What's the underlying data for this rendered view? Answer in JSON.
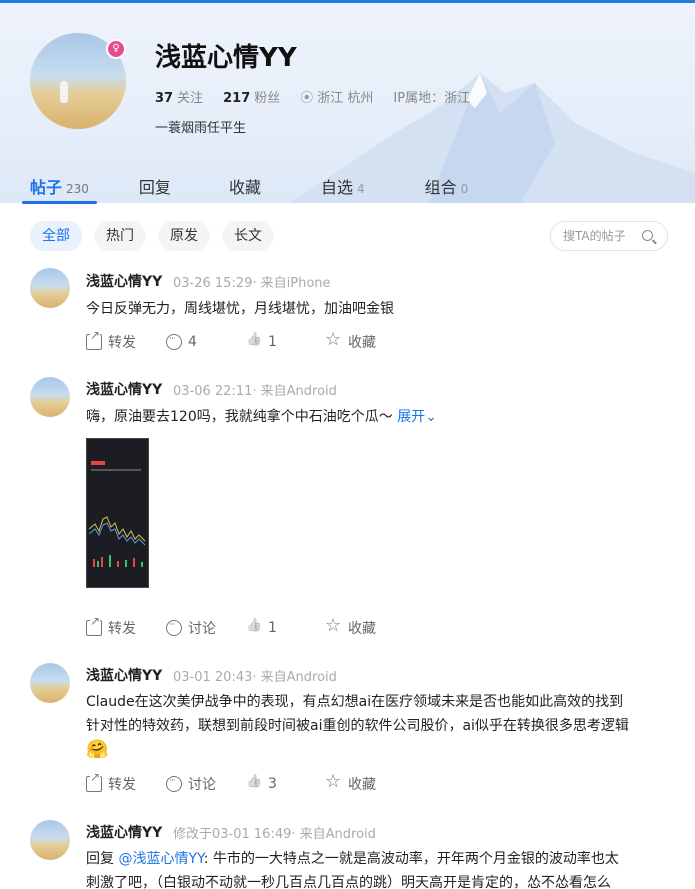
{
  "profile": {
    "name": "浅蓝心情YY",
    "following_count": "37",
    "following_label": "关注",
    "followers_count": "217",
    "followers_label": "粉丝",
    "location": "浙江 杭州",
    "ip_location": "IP属地：浙江",
    "bio": "一蓑烟雨任平生"
  },
  "tabs": [
    {
      "label": "帖子",
      "count": "230"
    },
    {
      "label": "回复",
      "count": ""
    },
    {
      "label": "收藏",
      "count": ""
    },
    {
      "label": "自选",
      "count": "4"
    },
    {
      "label": "组合",
      "count": "0"
    }
  ],
  "filters": [
    "全部",
    "热门",
    "原发",
    "长文"
  ],
  "search": {
    "placeholder": "搜TA的帖子"
  },
  "posts": [
    {
      "author": "浅蓝心情YY",
      "meta": "03-26 15:29· 来自iPhone",
      "body": "今日反弹无力，周线堪忧，月线堪忧，加油吧金银",
      "share": "转发",
      "comments": "4",
      "likes": "1",
      "fav": "收藏"
    },
    {
      "author": "浅蓝心情YY",
      "meta": "03-06 22:11· 来自Android",
      "body": "嗨，原油要去120吗，我就纯拿个中石油吃个瓜～",
      "expand": "展开",
      "share": "转发",
      "comments": "讨论",
      "likes": "1",
      "fav": "收藏"
    },
    {
      "author": "浅蓝心情YY",
      "meta": "03-01 20:43· 来自Android",
      "body_line1": "Claude在这次美伊战争中的表现，有点幻想ai在医疗领域未来是否也能如此高效的找到",
      "body_line2": "针对性的特效药，联想到前段时间被ai重创的软件公司股价，ai似乎在转换很多思考逻辑",
      "emoji": "🤗",
      "share": "转发",
      "comments": "讨论",
      "likes": "3",
      "fav": "收藏"
    },
    {
      "author": "浅蓝心情YY",
      "meta": "修改于03-01 16:49· 来自Android",
      "reply_prefix": "回复",
      "mention": "@浅蓝心情YY",
      "body_line1": ": 牛市的一大特点之一就是高波动率，开年两个月金银的波动率也太",
      "body_line2": "刺激了吧，（白银动不动就一秒几百点几百点的跳）明天高开是肯定的，怂不怂看怎么"
    }
  ]
}
